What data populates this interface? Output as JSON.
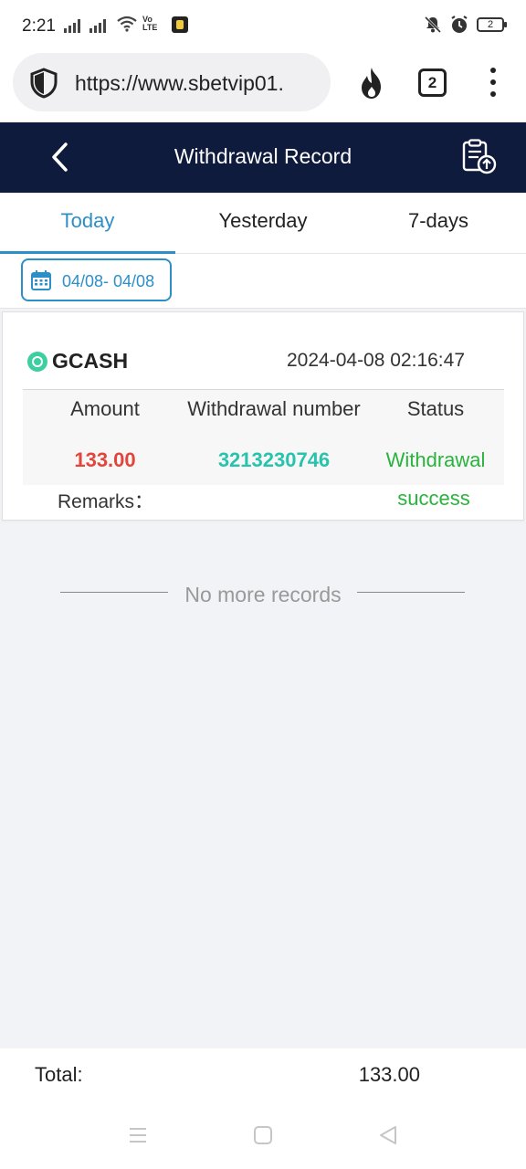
{
  "status_bar": {
    "time": "2:21",
    "volte_top": "Vo",
    "volte_bottom": "LTE",
    "battery": "2"
  },
  "browser": {
    "url": "https://www.sbetvip01.",
    "tab_count": "2"
  },
  "header": {
    "title": "Withdrawal Record"
  },
  "tabs": [
    {
      "label": "Today",
      "active": true
    },
    {
      "label": "Yesterday",
      "active": false
    },
    {
      "label": "7-days",
      "active": false
    }
  ],
  "filter": {
    "date_range": "04/08- 04/08"
  },
  "record": {
    "method": "GCASH",
    "datetime": "2024-04-08 02:16:47",
    "columns": {
      "amount": "Amount",
      "number": "Withdrawal number",
      "status": "Status"
    },
    "amount": "133.00",
    "number": "3213230746",
    "status_line1": "Withdrawal",
    "status_line2": "success",
    "remarks_label": "Remarks："
  },
  "no_more": "No more records",
  "footer": {
    "total_label": "Total:",
    "total_value": "133.00"
  },
  "colors": {
    "header_bg": "#0f1b3d",
    "accent": "#2c8fc8",
    "amount": "#e2463a",
    "number": "#28c3ad",
    "success": "#28b43c"
  }
}
